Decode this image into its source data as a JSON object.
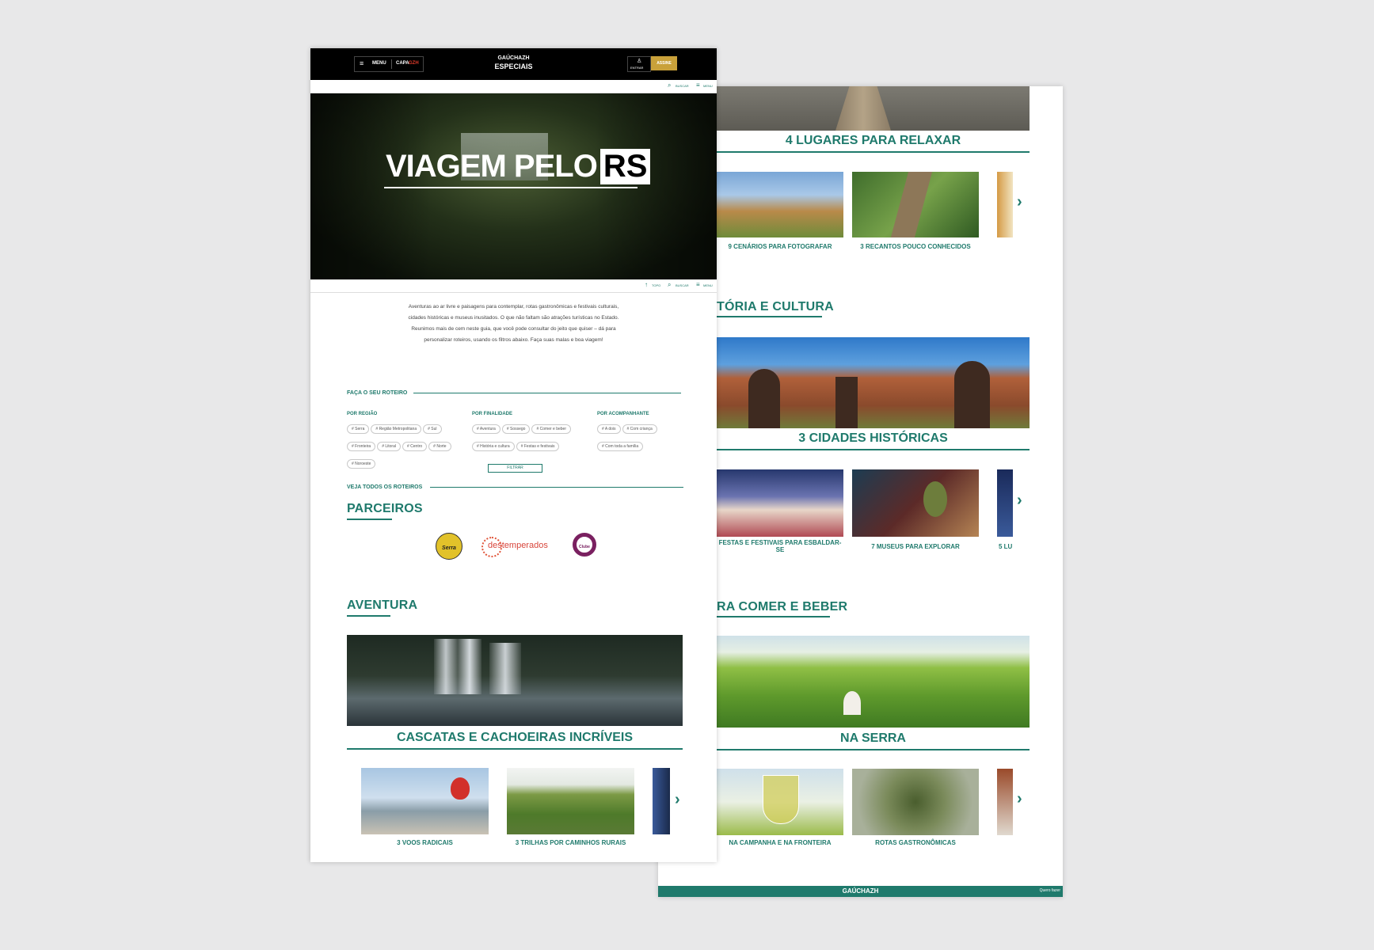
{
  "back": {
    "sections": [
      {
        "title": "4 LUGARES PARA RELAXAR"
      },
      {
        "heading": "TÓRIA E CULTURA",
        "band": "3 CIDADES HISTÓRICAS"
      },
      {
        "heading": "RA COMER E BEBER",
        "band": "NA SERRA"
      }
    ],
    "row1": [
      "9 CENÁRIOS PARA FOTOGRAFAR",
      "3 RECANTOS POUCO CONHECIDOS"
    ],
    "row2": [
      "FESTAS E FESTIVAIS PARA ESBALDAR-SE",
      "7 MUSEUS PARA EXPLORAR",
      "5 LU"
    ],
    "row3": [
      "NA CAMPANHA E NA FRONTEIRA",
      "ROTAS GASTRONÔMICAS"
    ],
    "footer_logo": "GAÚCHAZH",
    "footer_right": "Quero fazer"
  },
  "front": {
    "header": {
      "menu": "MENU",
      "capa": "CAPA",
      "gzh": "GZH",
      "brand_top": "GAÚCHAZH",
      "brand_bottom": "ESPECIAIS",
      "entrar": "ENTRAR",
      "assine": "ASSINE"
    },
    "subnav": {
      "buscar": "BUSCAR",
      "menu": "MENU",
      "topo": "TOPO"
    },
    "hero": {
      "title_main": "VIAGEM PELO",
      "title_box": "RS"
    },
    "intro": "Aventuras ao ar livre e paisagens para contemplar, rotas gastronômicas e festivais culturais, cidades históricas e museus inusitados. O que não faltam são atrações turísticas no Estado. Reunimos mais de cem neste guia, que você pode consultar do jeito que quiser – dá para personalizar roteiros, usando os filtros abaixo. Faça suas malas e boa viagem!",
    "roteiro_title": "FAÇA O SEU ROTEIRO",
    "filters": [
      {
        "title": "POR REGIÃO",
        "tags": [
          "# Serra",
          "# Região Metropolitana",
          "# Sul",
          "# Fronteira",
          "# Litoral",
          "# Centro",
          "# Norte",
          "# Noroeste"
        ]
      },
      {
        "title": "POR FINALIDADE",
        "tags": [
          "# Aventura",
          "# Sossego",
          "# Comer e beber",
          "# História e cultura",
          "# Festas e festivais"
        ]
      },
      {
        "title": "POR ACOMPANHANTE",
        "tags": [
          "# A dois",
          "# Com criança",
          "# Com toda a família"
        ]
      }
    ],
    "filtrar": "FILTRAR",
    "veja_todos": "VEJA TODOS OS ROTEIROS",
    "parceiros": "PARCEIROS",
    "partners": [
      "Serra",
      "destemperados",
      "Clube"
    ],
    "aventura": "AVENTURA",
    "band": "CASCATAS E CACHOEIRAS INCRÍVEIS",
    "cards": [
      "3 VOOS RADICAIS",
      "3 TRILHAS POR CAMINHOS RURAIS"
    ]
  },
  "colors": {
    "teal": "#1f7a6c",
    "gold": "#c9a13a",
    "black": "#000000"
  }
}
